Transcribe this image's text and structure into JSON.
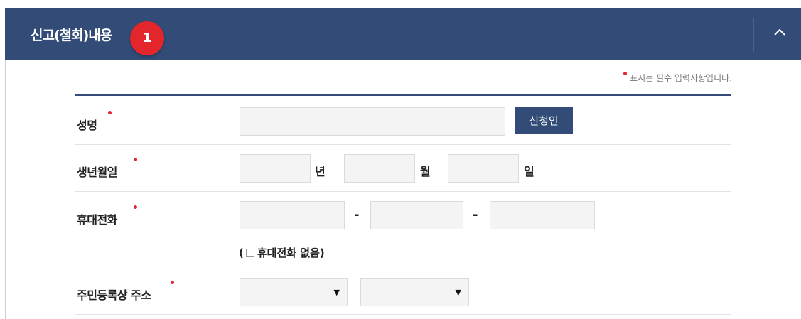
{
  "header": {
    "title": "신고(철회)내용",
    "step_number": "1"
  },
  "required_note": "표시는 필수 입력사항입니다.",
  "form": {
    "name": {
      "label": "성명",
      "value": "",
      "button_label": "신청인"
    },
    "birthdate": {
      "label": "생년월일",
      "year_unit": "년",
      "month_unit": "월",
      "day_unit": "일"
    },
    "mobile": {
      "label": "휴대전화",
      "separator": "-",
      "no_phone_open": "(",
      "no_phone_label": "휴대전화 없음)"
    },
    "address": {
      "label": "주민등록상 주소"
    }
  },
  "colors": {
    "header_bg": "#324b77",
    "required_dot": "#e3262c",
    "badge": "#e3262c"
  }
}
